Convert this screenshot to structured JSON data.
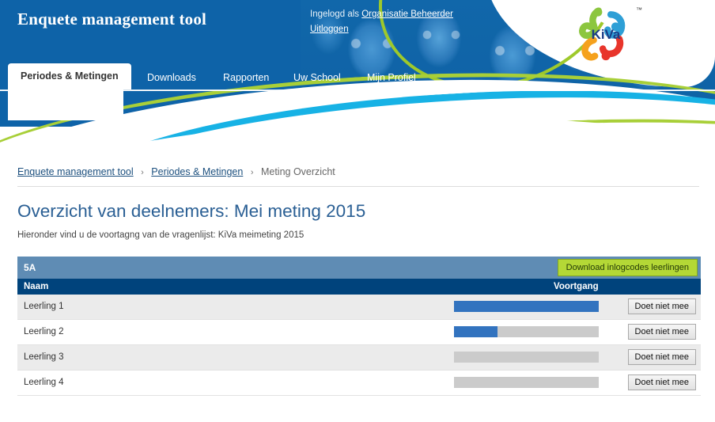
{
  "header": {
    "app_title": "Enquete management tool",
    "logged_in_prefix": "Ingelogd als",
    "logged_in_user": "Organisatie Beheerder",
    "logout_label": "Uitloggen",
    "logo_text": "KiVa",
    "logo_tm": "™",
    "blue": "#0e63a8",
    "green_accent": "#a8cf38",
    "cyan_accent": "#17b2e5"
  },
  "nav": {
    "tabs": [
      {
        "label": "Periodes & Metingen",
        "active": true
      },
      {
        "label": "Downloads",
        "active": false
      },
      {
        "label": "Rapporten",
        "active": false
      },
      {
        "label": "Uw School",
        "active": false
      },
      {
        "label": "Mijn Profiel",
        "active": false
      }
    ]
  },
  "breadcrumb": {
    "items": [
      {
        "label": "Enquete management tool",
        "link": true
      },
      {
        "label": "Periodes & Metingen",
        "link": true
      },
      {
        "label": "Meting Overzicht",
        "link": false
      }
    ],
    "separator": "›"
  },
  "page": {
    "title": "Overzicht van deelnemers: Mei meting 2015",
    "subtitle": "Hieronder vind u de voortagng van de vragenlijst: KiVa meimeting 2015"
  },
  "table": {
    "class_name": "5A",
    "download_button": "Download inlogcodes leerlingen",
    "columns": {
      "name": "Naam",
      "progress": "Voortgang"
    },
    "optout_label": "Doet niet mee",
    "rows": [
      {
        "name": "Leerling 1",
        "progress": 100,
        "optout": "Doet niet mee"
      },
      {
        "name": "Leerling 2",
        "progress": 30,
        "optout": "Doet niet mee"
      },
      {
        "name": "Leerling 3",
        "progress": 0,
        "optout": "Doet niet mee"
      },
      {
        "name": "Leerling 4",
        "progress": 0,
        "optout": "Doet niet mee"
      }
    ],
    "colors": {
      "class_bar": "#5f8cb4",
      "header_row": "#00437c",
      "progress_fill": "#3273bf",
      "progress_track": "#cbcbcb",
      "download_button": "#b4d836"
    }
  }
}
